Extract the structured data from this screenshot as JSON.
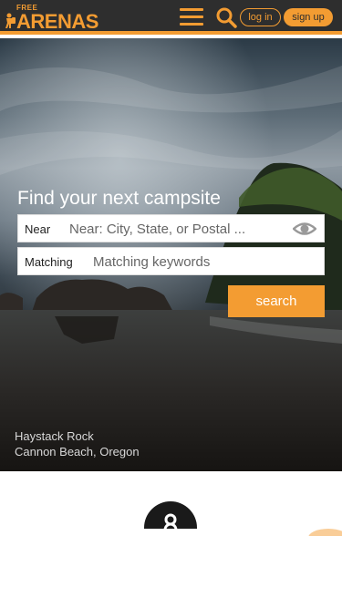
{
  "header": {
    "logo_small": "FREE",
    "logo_main": "ARENAS",
    "login_label": "log in",
    "signup_label": "sign up"
  },
  "hero": {
    "title": "Find your next campsite",
    "near_label": "Near",
    "near_placeholder": "Near: City, State, or Postal ...",
    "matching_label": "Matching",
    "matching_placeholder": "Matching keywords",
    "search_label": "search",
    "caption_line1": "Haystack Rock",
    "caption_line2": "Cannon Beach, Oregon"
  },
  "colors": {
    "accent": "#f39c32",
    "header_bg": "#2e2e2e"
  },
  "icons": {
    "menu": "hamburger-icon",
    "search": "search-icon",
    "locate": "eye-locate-icon",
    "feature": "circle-eight-icon"
  }
}
